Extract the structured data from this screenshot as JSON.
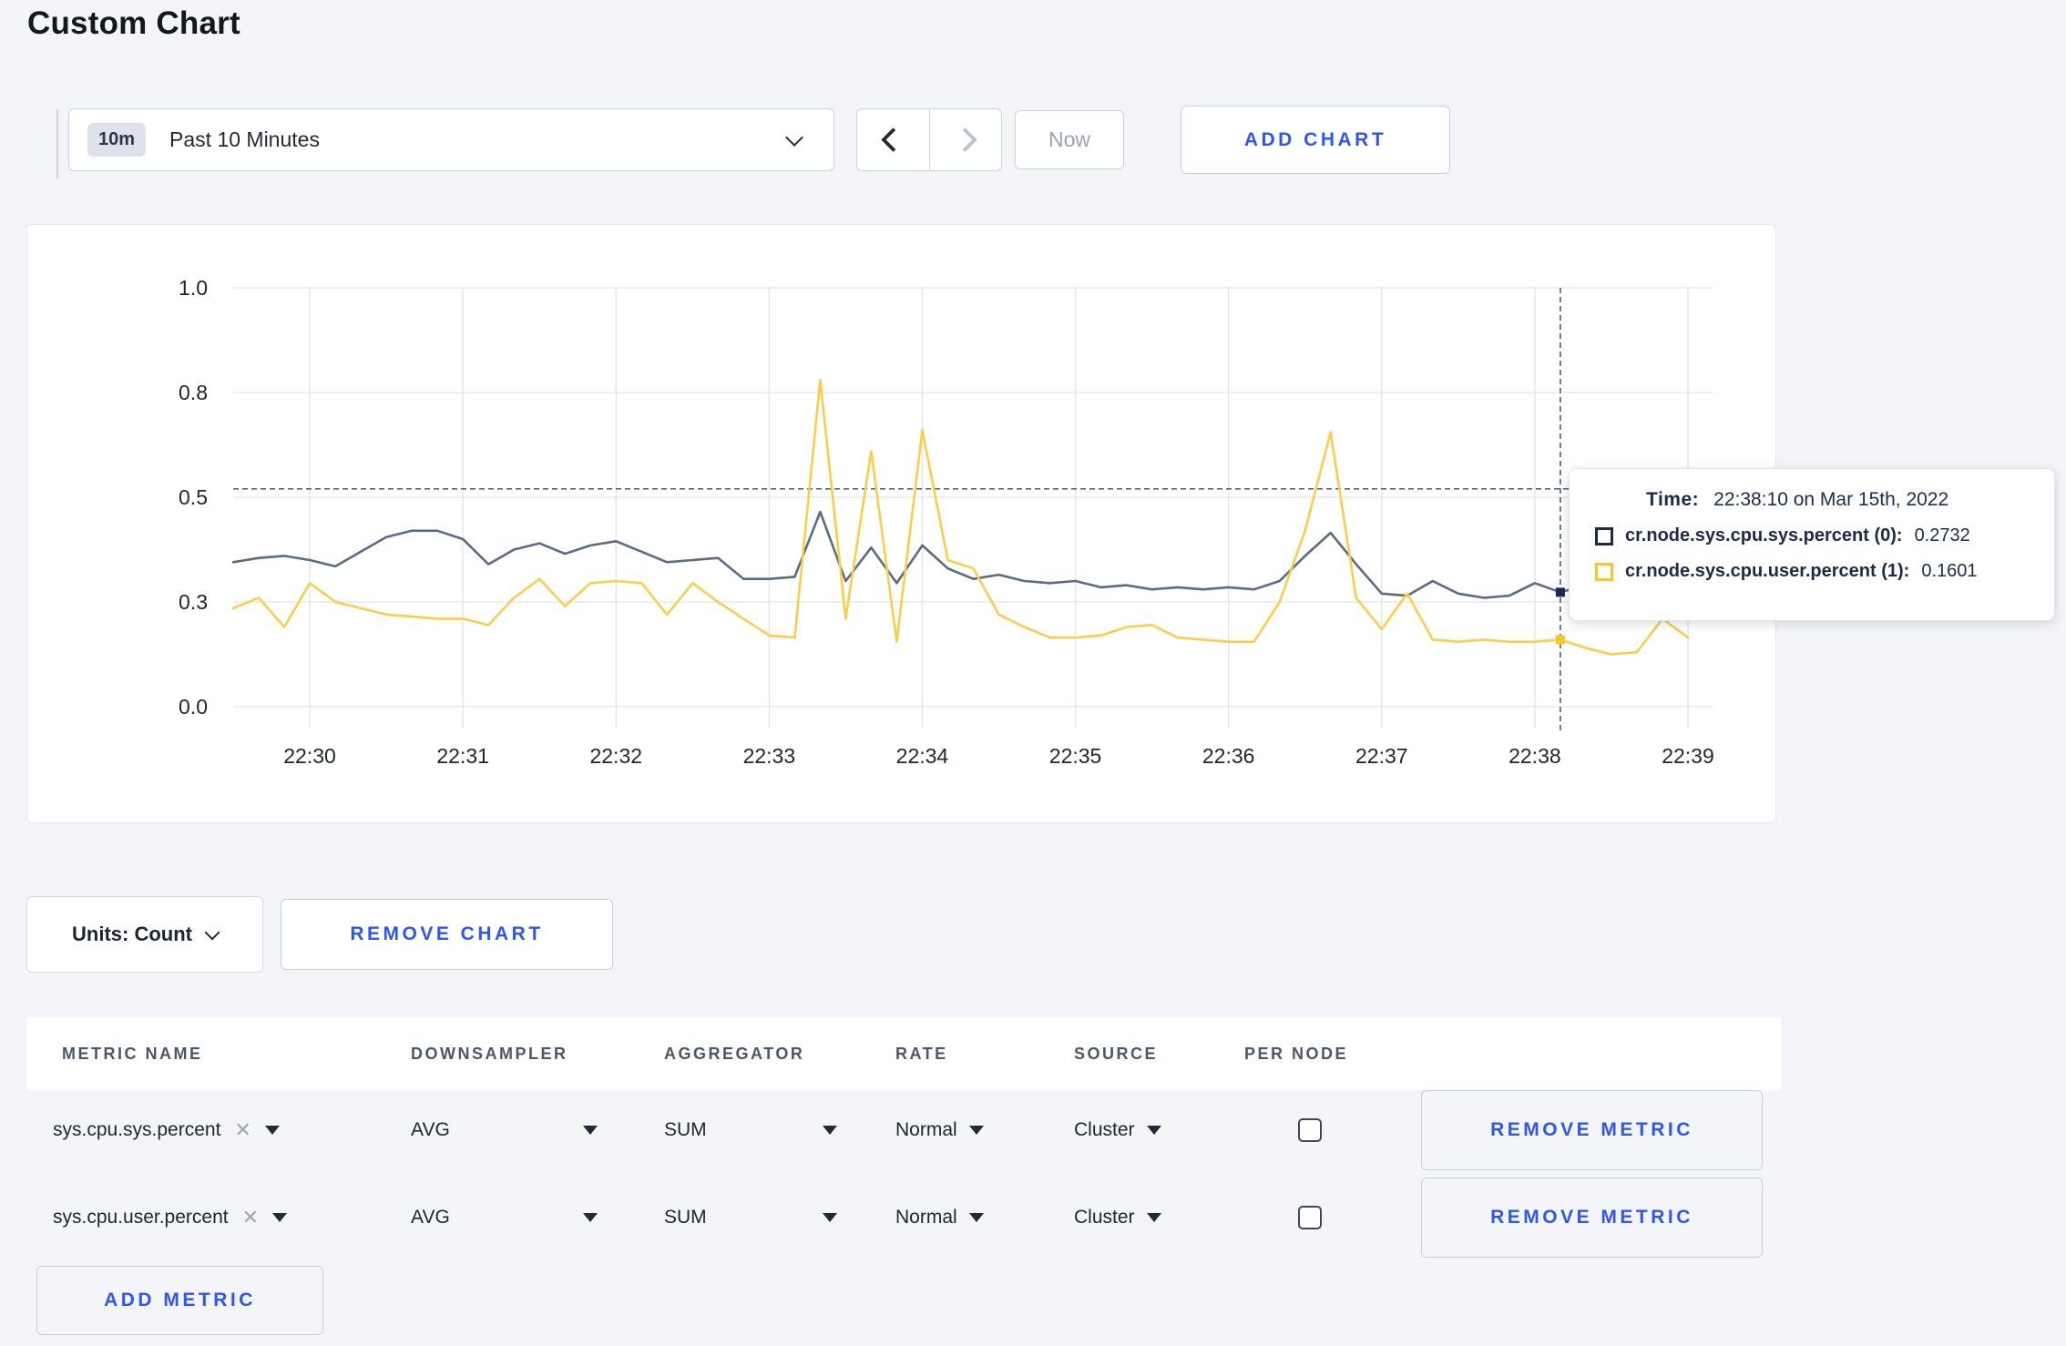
{
  "page": {
    "title": "Custom Chart"
  },
  "toolbar": {
    "time_badge": "10m",
    "time_range_label": "Past 10 Minutes",
    "now_label": "Now",
    "add_chart_label": "ADD CHART"
  },
  "chart_data": {
    "type": "line",
    "title": "",
    "xlabel": "",
    "ylabel": "",
    "grid": true,
    "legend_position": "tooltip",
    "x_tick_labels": [
      "22:30",
      "22:31",
      "22:32",
      "22:33",
      "22:34",
      "22:35",
      "22:36",
      "22:37",
      "22:38",
      "22:39"
    ],
    "y_tick_labels": [
      "0.0",
      "0.3",
      "0.5",
      "0.8",
      "1.0"
    ],
    "y_tick_fractions": [
      0,
      0.25,
      0.5,
      0.75,
      1
    ],
    "ylim": [
      0,
      1
    ],
    "x_start_seconds": -30,
    "x_step_seconds": 10,
    "x_domain_seconds": [
      -30,
      550
    ],
    "series": [
      {
        "name": "cr.node.sys.cpu.sys.percent (0)",
        "color": "#5c6b84",
        "swatch_color": "#1c2b4a",
        "values": [
          0.345,
          0.355,
          0.36,
          0.35,
          0.335,
          0.37,
          0.405,
          0.42,
          0.42,
          0.4,
          0.34,
          0.375,
          0.39,
          0.365,
          0.385,
          0.395,
          0.37,
          0.345,
          0.35,
          0.355,
          0.305,
          0.305,
          0.31,
          0.465,
          0.3,
          0.38,
          0.295,
          0.385,
          0.33,
          0.305,
          0.315,
          0.3,
          0.295,
          0.3,
          0.285,
          0.29,
          0.28,
          0.285,
          0.28,
          0.285,
          0.28,
          0.3,
          0.36,
          0.415,
          0.34,
          0.27,
          0.265,
          0.3,
          0.27,
          0.26,
          0.265,
          0.295,
          0.2732,
          0.29,
          0.3,
          0.3,
          0.305,
          0.3
        ]
      },
      {
        "name": "cr.node.sys.cpu.user.percent (1)",
        "color": "#fccd4c",
        "swatch_color": "#fcc426",
        "values": [
          0.235,
          0.26,
          0.19,
          0.295,
          0.25,
          0.235,
          0.22,
          0.215,
          0.21,
          0.21,
          0.195,
          0.26,
          0.305,
          0.24,
          0.295,
          0.3,
          0.295,
          0.22,
          0.295,
          0.25,
          0.21,
          0.17,
          0.165,
          0.78,
          0.21,
          0.61,
          0.155,
          0.66,
          0.35,
          0.33,
          0.22,
          0.19,
          0.165,
          0.165,
          0.17,
          0.19,
          0.195,
          0.165,
          0.16,
          0.155,
          0.155,
          0.25,
          0.42,
          0.655,
          0.26,
          0.185,
          0.27,
          0.16,
          0.155,
          0.16,
          0.155,
          0.155,
          0.1601,
          0.14,
          0.125,
          0.13,
          0.21,
          0.165
        ]
      }
    ],
    "crosshair": {
      "time_seconds": 490,
      "time_label": "22:38:10",
      "hline_fraction": 0.52,
      "sys_value": 0.2732,
      "user_value": 0.1601
    }
  },
  "tooltip": {
    "time_label": "Time:",
    "time_value": "22:38:10 on Mar 15th, 2022",
    "series": [
      {
        "name": "cr.node.sys.cpu.sys.percent (0):",
        "value": "0.2732",
        "swatch_color": "#1c2b4a"
      },
      {
        "name": "cr.node.sys.cpu.user.percent (1):",
        "value": "0.1601",
        "swatch_color": "#fcc426"
      }
    ]
  },
  "chart_controls": {
    "units_label": "Units: Count",
    "remove_chart_label": "REMOVE CHART"
  },
  "metrics_table": {
    "headers": [
      "METRIC NAME",
      "DOWNSAMPLER",
      "AGGREGATOR",
      "RATE",
      "SOURCE",
      "PER NODE"
    ],
    "rows": [
      {
        "metric": "sys.cpu.sys.percent",
        "downsampler": "AVG",
        "aggregator": "SUM",
        "rate": "Normal",
        "source": "Cluster",
        "per_node_checked": false,
        "remove_label": "REMOVE METRIC"
      },
      {
        "metric": "sys.cpu.user.percent",
        "downsampler": "AVG",
        "aggregator": "SUM",
        "rate": "Normal",
        "source": "Cluster",
        "per_node_checked": false,
        "remove_label": "REMOVE METRIC"
      }
    ],
    "add_metric_label": "ADD METRIC"
  },
  "colors": {
    "accent_blue": "#2f55f2",
    "page_background": "#f4f5f8",
    "gridline": "#e7e8eb",
    "crosshair": "#50677f"
  }
}
